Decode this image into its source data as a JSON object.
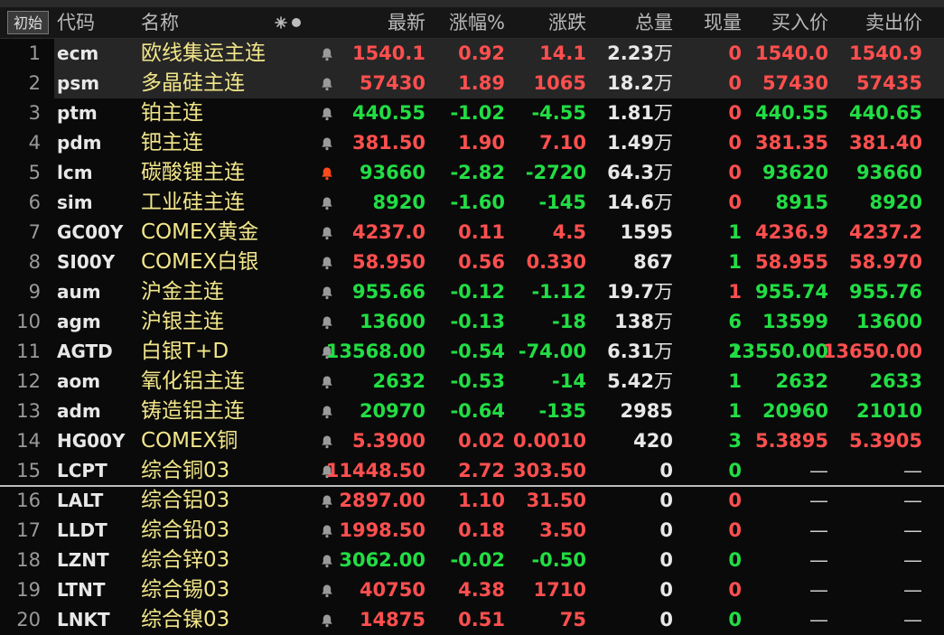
{
  "header": {
    "init_button": "初始",
    "columns": {
      "code": "代码",
      "name": "名称",
      "price": "最新",
      "pct": "涨幅%",
      "chg": "涨跌",
      "vol": "总量",
      "cur": "现量",
      "bid": "买入价",
      "ask": "卖出价"
    }
  },
  "colors": {
    "up": "#ff4f4f",
    "down": "#22dd44",
    "name": "#f2e68a",
    "alert_active": "#ff4a1c",
    "alert_idle": "#9a9a9a"
  },
  "rows": [
    {
      "num": "1",
      "code": "ecm",
      "name": "欧线集运主连",
      "price": "1540.1",
      "pct": "0.92",
      "chg": "14.1",
      "vol": "2.23",
      "vol_unit": "万",
      "cur": "0",
      "bid": "1540.0",
      "ask": "1540.9",
      "dir": "up",
      "cur_dir": "up",
      "bid_dir": "up",
      "ask_dir": "up",
      "alert": "idle",
      "selected": true
    },
    {
      "num": "2",
      "code": "psm",
      "name": "多晶硅主连",
      "price": "57430",
      "pct": "1.89",
      "chg": "1065",
      "vol": "18.2",
      "vol_unit": "万",
      "cur": "0",
      "bid": "57430",
      "ask": "57435",
      "dir": "up",
      "cur_dir": "up",
      "bid_dir": "up",
      "ask_dir": "up",
      "alert": "idle",
      "selected": true
    },
    {
      "num": "3",
      "code": "ptm",
      "name": "铂主连",
      "price": "440.55",
      "pct": "-1.02",
      "chg": "-4.55",
      "vol": "1.81",
      "vol_unit": "万",
      "cur": "0",
      "bid": "440.55",
      "ask": "440.65",
      "dir": "dn",
      "cur_dir": "up",
      "bid_dir": "dn",
      "ask_dir": "dn",
      "alert": "idle"
    },
    {
      "num": "4",
      "code": "pdm",
      "name": "钯主连",
      "price": "381.50",
      "pct": "1.90",
      "chg": "7.10",
      "vol": "1.49",
      "vol_unit": "万",
      "cur": "0",
      "bid": "381.35",
      "ask": "381.40",
      "dir": "up",
      "cur_dir": "up",
      "bid_dir": "up",
      "ask_dir": "up",
      "alert": "idle"
    },
    {
      "num": "5",
      "code": "lcm",
      "name": "碳酸锂主连",
      "price": "93660",
      "pct": "-2.82",
      "chg": "-2720",
      "vol": "64.3",
      "vol_unit": "万",
      "cur": "0",
      "bid": "93620",
      "ask": "93660",
      "dir": "dn",
      "cur_dir": "up",
      "bid_dir": "dn",
      "ask_dir": "dn",
      "alert": "active"
    },
    {
      "num": "6",
      "code": "sim",
      "name": "工业硅主连",
      "price": "8920",
      "pct": "-1.60",
      "chg": "-145",
      "vol": "14.6",
      "vol_unit": "万",
      "cur": "0",
      "bid": "8915",
      "ask": "8920",
      "dir": "dn",
      "cur_dir": "up",
      "bid_dir": "dn",
      "ask_dir": "dn",
      "alert": "idle"
    },
    {
      "num": "7",
      "code": "GC00Y",
      "name": "COMEX黄金",
      "price": "4237.0",
      "pct": "0.11",
      "chg": "4.5",
      "vol": "1595",
      "vol_unit": "",
      "cur": "1",
      "bid": "4236.9",
      "ask": "4237.2",
      "dir": "up",
      "cur_dir": "dn",
      "bid_dir": "up",
      "ask_dir": "up",
      "alert": "idle"
    },
    {
      "num": "8",
      "code": "SI00Y",
      "name": "COMEX白银",
      "price": "58.950",
      "pct": "0.56",
      "chg": "0.330",
      "vol": "867",
      "vol_unit": "",
      "cur": "1",
      "bid": "58.955",
      "ask": "58.970",
      "dir": "up",
      "cur_dir": "dn",
      "bid_dir": "up",
      "ask_dir": "up",
      "alert": "idle"
    },
    {
      "num": "9",
      "code": "aum",
      "name": "沪金主连",
      "price": "955.66",
      "pct": "-0.12",
      "chg": "-1.12",
      "vol": "19.7",
      "vol_unit": "万",
      "cur": "1",
      "bid": "955.74",
      "ask": "955.76",
      "dir": "dn",
      "cur_dir": "up",
      "bid_dir": "dn",
      "ask_dir": "dn",
      "alert": "idle"
    },
    {
      "num": "10",
      "code": "agm",
      "name": "沪银主连",
      "price": "13600",
      "pct": "-0.13",
      "chg": "-18",
      "vol": "138",
      "vol_unit": "万",
      "cur": "6",
      "bid": "13599",
      "ask": "13600",
      "dir": "dn",
      "cur_dir": "dn",
      "bid_dir": "dn",
      "ask_dir": "dn",
      "alert": "idle"
    },
    {
      "num": "11",
      "code": "AGTD",
      "name": "白银T+D",
      "price": "13568.00",
      "pct": "-0.54",
      "chg": "-74.00",
      "vol": "6.31",
      "vol_unit": "万",
      "cur": "2",
      "bid": "13550.00",
      "ask": "13650.00",
      "dir": "dn",
      "cur_dir": "dn",
      "bid_dir": "dn",
      "ask_dir": "up",
      "alert": "idle"
    },
    {
      "num": "12",
      "code": "aom",
      "name": "氧化铝主连",
      "price": "2632",
      "pct": "-0.53",
      "chg": "-14",
      "vol": "5.42",
      "vol_unit": "万",
      "cur": "1",
      "bid": "2632",
      "ask": "2633",
      "dir": "dn",
      "cur_dir": "dn",
      "bid_dir": "dn",
      "ask_dir": "dn",
      "alert": "idle"
    },
    {
      "num": "13",
      "code": "adm",
      "name": "铸造铝主连",
      "price": "20970",
      "pct": "-0.64",
      "chg": "-135",
      "vol": "2985",
      "vol_unit": "",
      "cur": "1",
      "bid": "20960",
      "ask": "21010",
      "dir": "dn",
      "cur_dir": "dn",
      "bid_dir": "dn",
      "ask_dir": "dn",
      "alert": "idle"
    },
    {
      "num": "14",
      "code": "HG00Y",
      "name": "COMEX铜",
      "price": "5.3900",
      "pct": "0.02",
      "chg": "0.0010",
      "vol": "420",
      "vol_unit": "",
      "cur": "3",
      "bid": "5.3895",
      "ask": "5.3905",
      "dir": "up",
      "cur_dir": "dn",
      "bid_dir": "up",
      "ask_dir": "up",
      "alert": "idle"
    },
    {
      "num": "15",
      "code": "LCPT",
      "name": "综合铜03",
      "price": "11448.50",
      "pct": "2.72",
      "chg": "303.50",
      "vol": "0",
      "vol_unit": "",
      "cur": "0",
      "bid": "—",
      "ask": "—",
      "dir": "up",
      "cur_dir": "dn",
      "bid_dir": "dash",
      "ask_dir": "dash",
      "alert": "idle"
    },
    {
      "num": "16",
      "code": "LALT",
      "name": "综合铝03",
      "price": "2897.00",
      "pct": "1.10",
      "chg": "31.50",
      "vol": "0",
      "vol_unit": "",
      "cur": "0",
      "bid": "—",
      "ask": "—",
      "dir": "up",
      "cur_dir": "up",
      "bid_dir": "dash",
      "ask_dir": "dash",
      "alert": "idle"
    },
    {
      "num": "17",
      "code": "LLDT",
      "name": "综合铅03",
      "price": "1998.50",
      "pct": "0.18",
      "chg": "3.50",
      "vol": "0",
      "vol_unit": "",
      "cur": "0",
      "bid": "—",
      "ask": "—",
      "dir": "up",
      "cur_dir": "up",
      "bid_dir": "dash",
      "ask_dir": "dash",
      "alert": "idle"
    },
    {
      "num": "18",
      "code": "LZNT",
      "name": "综合锌03",
      "price": "3062.00",
      "pct": "-0.02",
      "chg": "-0.50",
      "vol": "0",
      "vol_unit": "",
      "cur": "0",
      "bid": "—",
      "ask": "—",
      "dir": "dn",
      "cur_dir": "dn",
      "bid_dir": "dash",
      "ask_dir": "dash",
      "alert": "idle"
    },
    {
      "num": "19",
      "code": "LTNT",
      "name": "综合锡03",
      "price": "40750",
      "pct": "4.38",
      "chg": "1710",
      "vol": "0",
      "vol_unit": "",
      "cur": "0",
      "bid": "—",
      "ask": "—",
      "dir": "up",
      "cur_dir": "up",
      "bid_dir": "dash",
      "ask_dir": "dash",
      "alert": "idle"
    },
    {
      "num": "20",
      "code": "LNKT",
      "name": "综合镍03",
      "price": "14875",
      "pct": "0.51",
      "chg": "75",
      "vol": "0",
      "vol_unit": "",
      "cur": "0",
      "bid": "—",
      "ask": "—",
      "dir": "up",
      "cur_dir": "dn",
      "bid_dir": "dash",
      "ask_dir": "dash",
      "alert": "idle"
    }
  ]
}
